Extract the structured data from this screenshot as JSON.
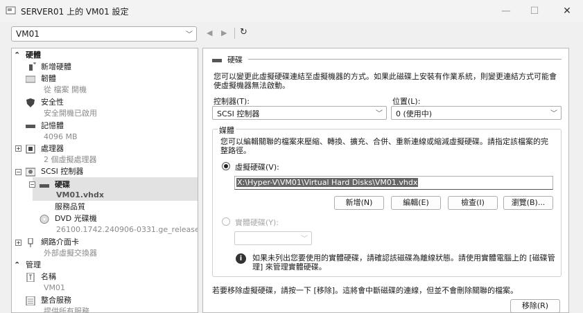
{
  "window": {
    "title": "SERVER01 上的 VM01 設定",
    "minimize": "—",
    "maximize": "☐",
    "close": "✕"
  },
  "toolbar": {
    "vm_selected": "VM01",
    "back_icon": "◀",
    "forward_icon": "▶",
    "refresh_icon": "↻"
  },
  "tree": {
    "hardware_header": "硬體",
    "add_hardware": "新增硬體",
    "firmware": "韌體",
    "firmware_sub": "從 檔案 開機",
    "security": "安全性",
    "security_sub": "安全開機已啟用",
    "memory": "記憶體",
    "memory_sub": "4096 MB",
    "processor": "處理器",
    "processor_sub": "2 個虛擬處理器",
    "scsi": "SCSI 控制器",
    "hard_drive": "硬碟",
    "hard_drive_sub": "VM01.vhdx",
    "qos": "服務品質",
    "dvd": "DVD 光碟機",
    "dvd_sub": "26100.1742.240906-0331.ge_release...",
    "nic": "網路介面卡",
    "nic_sub": "外部虛擬交換器",
    "management_header": "管理",
    "name": "名稱",
    "name_sub": "VM01",
    "integration": "整合服務",
    "integration_sub": "提供所有服務",
    "expand_plus": "+",
    "expand_minus": "−",
    "collapse_icon": "⌃"
  },
  "detail": {
    "section_title": "硬碟",
    "description": "您可以變更此虛擬硬碟連結至虛擬機器的方式。如果此磁碟上安裝有作業系統，則變更連結方式可能會使虛擬機器無法啟動。",
    "controller_label": "控制器(T):",
    "controller_value": "SCSI 控制器",
    "location_label": "位置(L):",
    "location_value": "0 (使用中)",
    "media_label": "媒體",
    "media_description": "您可以編輯關聯的檔案來壓縮、轉換、擴充、合併、重新連線或縮減虛擬硬碟。請指定該檔案的完整路徑。",
    "virtual_disk_label": "虛擬硬碟(V):",
    "virtual_disk_path": "X:\\Hyper-V\\VM01\\Virtual Hard Disks\\VM01.vhdx",
    "btn_new": "新增(N)",
    "btn_edit": "編輯(E)",
    "btn_inspect": "檢查(I)",
    "btn_browse": "瀏覽(B)...",
    "physical_disk_label": "實體硬碟(Y):",
    "info_text": "如果未列出您要使用的實體硬碟，請確認該磁碟為離線狀態。請使用實體電腦上的 [磁碟管理] 來管理實體硬碟。",
    "remove_text": "若要移除虛擬硬碟，請按一下 [移除]。這將會中斷磁碟的連線，但並不會刪除關聯的檔案。",
    "btn_remove": "移除(R)",
    "info_icon": "i"
  }
}
